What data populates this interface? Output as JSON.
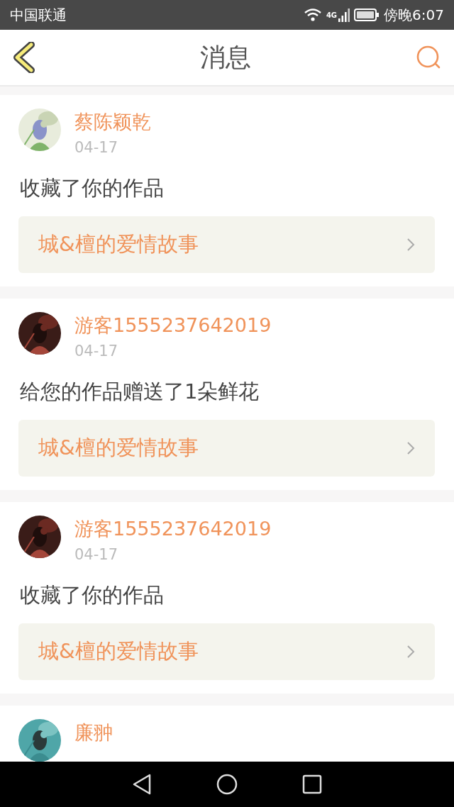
{
  "status_bar": {
    "carrier": "中国联通",
    "network": "4G",
    "time": "傍晚6:07"
  },
  "header": {
    "title": "消息"
  },
  "messages": [
    {
      "name": "蔡陈颖乾",
      "date": "04-17",
      "text": "收藏了你的作品",
      "work": "城&檀的爱情故事"
    },
    {
      "name": "游客1555237642019",
      "date": "04-17",
      "text": "给您的作品赠送了1朵鲜花",
      "work": "城&檀的爱情故事"
    },
    {
      "name": "游客1555237642019",
      "date": "04-17",
      "text": "收藏了你的作品",
      "work": "城&檀的爱情故事"
    },
    {
      "name": "廉翀"
    }
  ]
}
